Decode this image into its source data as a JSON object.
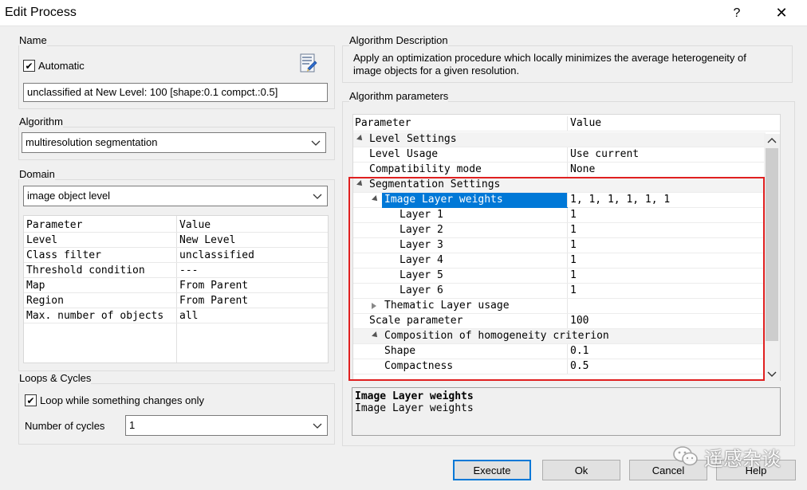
{
  "window": {
    "title": "Edit Process",
    "help": "?",
    "close": "✕"
  },
  "name_group": {
    "label": "Name",
    "automatic_label": "Automatic",
    "automatic_checked": true,
    "value": "unclassified at  New Level: 100 [shape:0.1 compct.:0.5]"
  },
  "algorithm_group": {
    "label": "Algorithm",
    "selected": "multiresolution segmentation"
  },
  "domain_group": {
    "label": "Domain",
    "selected": "image object level",
    "header": {
      "param": "Parameter",
      "value": "Value"
    },
    "rows": [
      {
        "param": "Level",
        "value": "New Level"
      },
      {
        "param": "Class filter",
        "value": "unclassified"
      },
      {
        "param": "Threshold condition",
        "value": "---"
      },
      {
        "param": "Map",
        "value": "From Parent"
      },
      {
        "param": "Region",
        "value": "From Parent"
      },
      {
        "param": "Max. number of objects",
        "value": "all"
      }
    ]
  },
  "loops_group": {
    "label": "Loops & Cycles",
    "loop_label": "Loop while something changes only",
    "loop_checked": true,
    "cycles_label": "Number of cycles",
    "cycles_value": "1"
  },
  "description_group": {
    "label": "Algorithm Description",
    "text": "Apply an optimization procedure which locally minimizes the average heterogeneity of image objects for a given resolution."
  },
  "params_group": {
    "label": "Algorithm parameters",
    "header": {
      "param": "Parameter",
      "value": "Value"
    },
    "rows": [
      {
        "name": "Level Settings",
        "value": ""
      },
      {
        "name": "Level Usage",
        "value": "Use current"
      },
      {
        "name": "Compatibility mode",
        "value": "None"
      },
      {
        "name": "Segmentation Settings",
        "value": ""
      },
      {
        "name": "Image Layer weights",
        "value": "1, 1, 1, 1, 1, 1"
      },
      {
        "name": "Layer 1",
        "value": "1"
      },
      {
        "name": "Layer 2",
        "value": "1"
      },
      {
        "name": "Layer 3",
        "value": "1"
      },
      {
        "name": "Layer 4",
        "value": "1"
      },
      {
        "name": "Layer 5",
        "value": "1"
      },
      {
        "name": "Layer 6",
        "value": "1"
      },
      {
        "name": "Thematic Layer usage",
        "value": ""
      },
      {
        "name": "Scale parameter",
        "value": "100"
      },
      {
        "name": "Composition of homogeneity criterion",
        "value": ""
      },
      {
        "name": "Shape",
        "value": "0.1"
      },
      {
        "name": "Compactness",
        "value": "0.5"
      }
    ],
    "selected_title": "Image Layer weights",
    "selected_desc": "Image Layer weights"
  },
  "buttons": {
    "execute": "Execute",
    "ok": "Ok",
    "cancel": "Cancel",
    "help": "Help"
  },
  "watermark": "遥感杂谈",
  "colors": {
    "highlight": "#e02020",
    "selection": "#0078d7"
  }
}
